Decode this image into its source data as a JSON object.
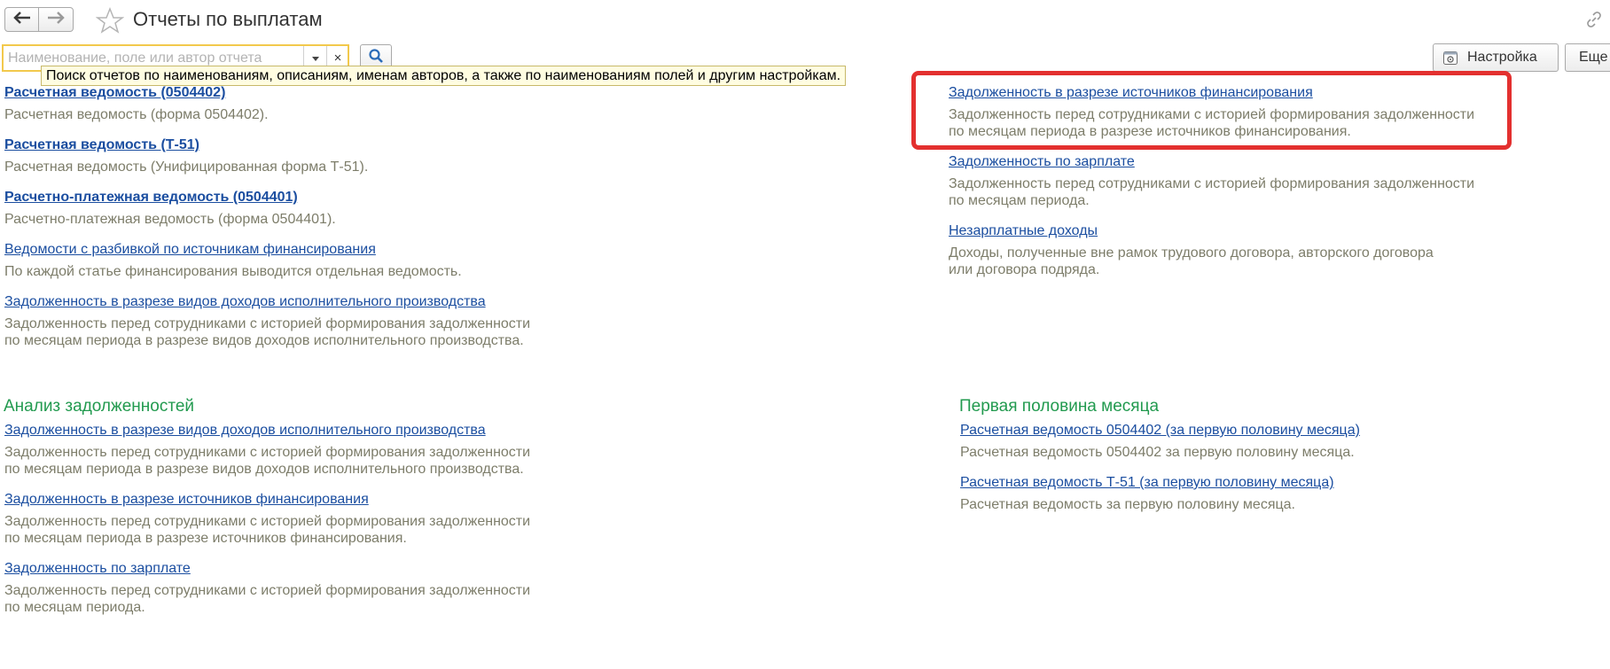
{
  "header": {
    "title": "Отчеты по выплатам",
    "back_icon": "arrow-left-icon",
    "forward_icon": "arrow-right-icon",
    "favorite_icon": "star-icon",
    "link_icon": "link-icon"
  },
  "search": {
    "value": "",
    "placeholder": "Наименование, поле или автор отчета",
    "tooltip": "Поиск отчетов по наименованиям, описаниям, именам авторов, а также по наименованиям полей и другим настройкам.",
    "clear_label": "×"
  },
  "toolbar": {
    "settings_label": "Настройка",
    "more_label": "Еще"
  },
  "left_column": {
    "items": [
      {
        "title": "Расчетная ведомость (0504402)",
        "bold": true,
        "description": "Расчетная ведомость (форма 0504402)."
      },
      {
        "title": "Расчетная ведомость (Т-51)",
        "bold": true,
        "description": "Расчетная ведомость (Унифицированная форма Т-51)."
      },
      {
        "title": "Расчетно-платежная ведомость (0504401)",
        "bold": true,
        "description": "Расчетно-платежная ведомость (форма 0504401)."
      },
      {
        "title": "Ведомости с разбивкой по источникам финансирования",
        "bold": false,
        "description": "По каждой статье финансирования выводится отдельная ведомость."
      },
      {
        "title": "Задолженность в разрезе видов доходов исполнительного производства",
        "bold": false,
        "description": "Задолженность перед сотрудниками с историей формирования задолженности\nпо месяцам периода в разрезе видов доходов исполнительного производства."
      }
    ]
  },
  "right_column": {
    "items": [
      {
        "title": "Задолженность в разрезе источников финансирования",
        "description": "Задолженность перед сотрудниками с историей формирования задолженности\nпо месяцам периода в разрезе источников финансирования."
      },
      {
        "title": "Задолженность по зарплате",
        "description": "Задолженность перед сотрудниками с историей формирования задолженности\nпо месяцам периода."
      },
      {
        "title": "Незарплатные доходы",
        "description": "Доходы, полученные вне рамок трудового договора, авторского договора\nили договора подряда."
      }
    ]
  },
  "group_debt": {
    "title": "Анализ задолженностей",
    "items": [
      {
        "title": "Задолженность в разрезе видов доходов исполнительного производства",
        "description": "Задолженность перед сотрудниками с историей формирования задолженности\nпо месяцам периода в разрезе видов доходов исполнительного производства."
      },
      {
        "title": "Задолженность в разрезе источников финансирования",
        "description": "Задолженность перед сотрудниками с историей формирования задолженности\nпо месяцам периода в разрезе источников финансирования."
      },
      {
        "title": "Задолженность по зарплате",
        "description": "Задолженность перед сотрудниками с историей формирования задолженности\nпо месяцам периода."
      }
    ]
  },
  "group_half_month": {
    "title": "Первая половина месяца",
    "items": [
      {
        "title": "Расчетная ведомость 0504402 (за первую половину месяца)",
        "description": "Расчетная ведомость 0504402 за первую половину месяца."
      },
      {
        "title": "Расчетная ведомость Т-51 (за первую половину месяца)",
        "description": "Расчетная ведомость за первую половину месяца."
      }
    ]
  },
  "colors": {
    "link": "#1b4ea0",
    "description": "#7d7d6a",
    "group_title": "#229a4f",
    "highlight": "#e3302f",
    "search_border": "#f2c94c",
    "tooltip_bg": "#fffde1"
  }
}
